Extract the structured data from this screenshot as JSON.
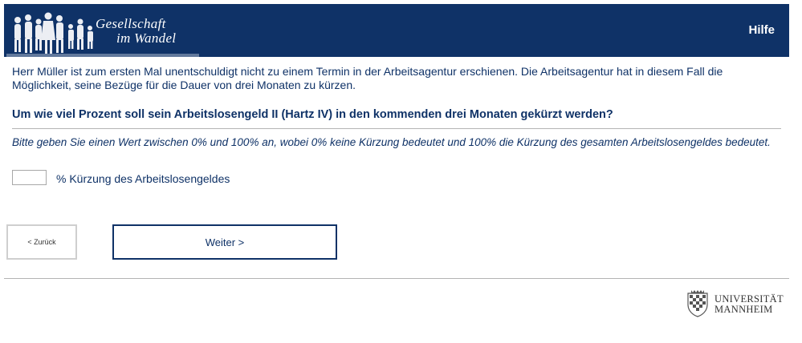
{
  "header": {
    "logo_line1": "Gesellschaft",
    "logo_line2": "im Wandel",
    "help_label": "Hilfe",
    "bg_color": "#0f3267"
  },
  "content": {
    "intro": "Herr Müller ist zum ersten Mal unentschuldigt nicht zu einem Termin in der Arbeitsagentur erschienen. Die Arbeitsagentur hat in diesem Fall die Möglichkeit, seine Bezüge für die Dauer von drei Monaten zu kürzen.",
    "question": "Um wie viel Prozent soll sein Arbeitslosengeld II (Hartz IV) in den kommenden drei Monaten gekürzt werden?",
    "hint": "Bitte geben Sie einen Wert zwischen 0% und 100% an, wobei 0% keine Kürzung bedeutet und 100% die Kürzung des gesamten Arbeitslosengeldes bedeutet.",
    "input_value": "",
    "input_label": "% Kürzung des Arbeitslosengeldes"
  },
  "nav": {
    "back_label": "< Zurück",
    "next_label": "Weiter >"
  },
  "footer": {
    "university_line1": "UNIVERSITÄT",
    "university_line2": "MANNHEIM"
  }
}
